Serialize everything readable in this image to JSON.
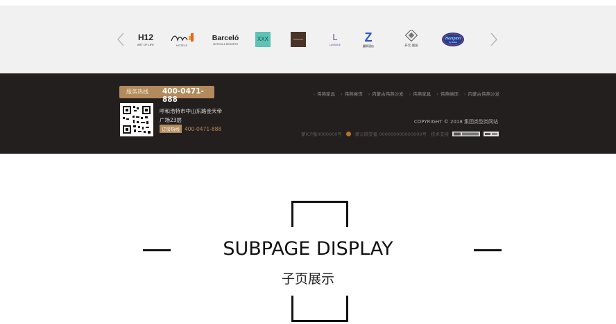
{
  "brands": {
    "prev_label": "‹",
    "next_label": "›",
    "items": [
      {
        "name": "H12",
        "sub": "ART OF LIFE"
      },
      {
        "name": "Ruta de Gala",
        "sub": "HOTELS"
      },
      {
        "name": "Barceló",
        "sub": "HOTELS & RESORTS"
      },
      {
        "name": "XXX",
        "sub": ""
      },
      {
        "name": "brown-square",
        "sub": ""
      },
      {
        "name": "L",
        "sub": "LAVANDE"
      },
      {
        "name": "Z",
        "sub": "麗枫酒店"
      },
      {
        "name": "ornament",
        "sub": "开元·曼居"
      },
      {
        "name": "Hampton",
        "sub": "by Hilton"
      }
    ]
  },
  "footer": {
    "hotline_label": "服务热线",
    "hotline_number": "400-0471-888",
    "address_line1": "呼和浩特市中山东路金天帝",
    "address_line2": "广场23层",
    "order_label": "订房热线",
    "order_number": "400-0471-888",
    "nav": [
      "伟燕家具",
      "伟燕摊饰",
      "内蒙古伟燕沙发",
      "伟燕家具",
      "伟燕摊饰",
      "内蒙古伟燕沙发"
    ],
    "copyright": "COPYRIGHT © 2018 集团类型类网站",
    "icp": "蒙ICP备0000000号",
    "police": "蒙公网安备 000000000000000号",
    "support_label": "技术支持",
    "accent": "#b38a5b",
    "bg": "#231f1e"
  },
  "section": {
    "title_en": "SUBPAGE DISPLAY",
    "title_cn": "子页展示"
  }
}
